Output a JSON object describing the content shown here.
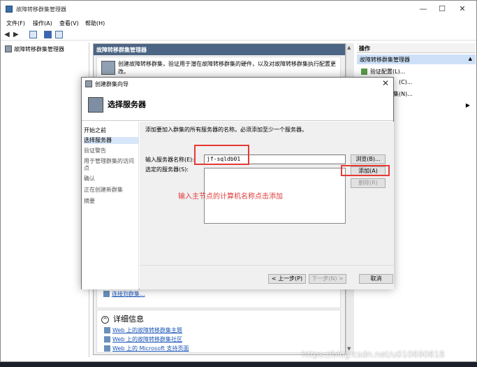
{
  "window": {
    "title": "故障转移群集管理器",
    "min": "—",
    "max": "☐",
    "close": "✕"
  },
  "menu": [
    "文件(F)",
    "操作(A)",
    "查看(V)",
    "帮助(H)"
  ],
  "toolbar": {
    "back": "◀",
    "forward": "▶"
  },
  "tree": {
    "root": "故障转移群集管理器"
  },
  "center": {
    "header": "故障转移群集管理器",
    "description": "创建故障转移群集，验证用于潜在故障转移群集的硬件，以及对故障转移群集执行配置更改。",
    "link_connect": "连接到群集...",
    "details_title": "详细信息",
    "details_toggle": "^",
    "details_links": [
      "Web 上的故障转移群集主题",
      "Web 上的故障转移群集社区",
      "Web 上的 Microsoft 支持页面"
    ]
  },
  "actions": {
    "header": "操作",
    "section": "故障转移群集管理器",
    "section_toggle": "▲",
    "items": [
      "验证配置(L)...",
      "(C)...",
      "集(N)..."
    ],
    "more_arrow": "▶"
  },
  "dialog": {
    "title": "创建群集向导",
    "close": "✕",
    "step_title": "选择服务器",
    "steps": [
      "开始之前",
      "选择服务器",
      "验证警告",
      "用于管理群集的访问点",
      "确认",
      "正在创建新群集",
      "摘要"
    ],
    "intro": "添加要加入群集的所有服务器的名称。必须添加至少一个服务器。",
    "server_name_label": "输入服务器名称(E):",
    "server_name_value": "jf-sqldb01",
    "selected_label": "选定的服务器(S):",
    "browse_btn": "浏览(B)...",
    "add_btn": "添加(A)",
    "remove_btn": "删除(R)",
    "annotation": "输入主节点的计算机名称点击添加",
    "prev_btn": "< 上一步(P)",
    "next_btn": "下一步(N) >",
    "cancel_btn": "取消"
  },
  "watermark": "https://blog.csdn.net/u010690818"
}
